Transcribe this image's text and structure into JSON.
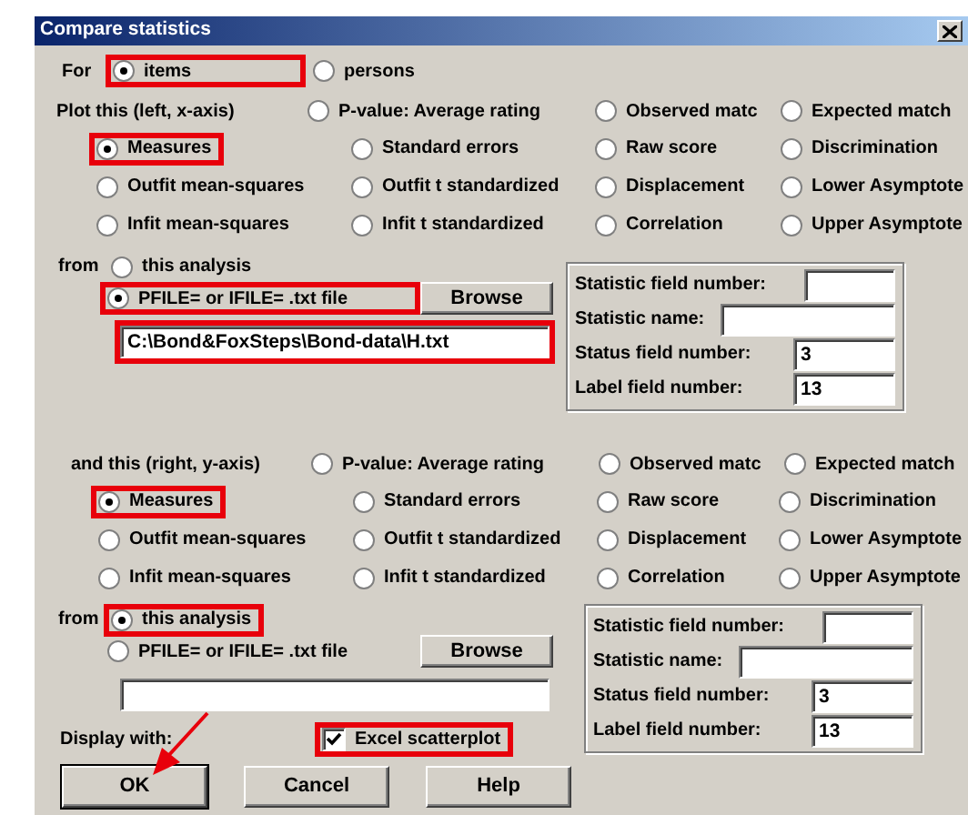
{
  "window": {
    "title": "Compare statistics"
  },
  "for": {
    "label": "For",
    "options": [
      {
        "label": "items",
        "selected": true,
        "highlighted": true
      },
      {
        "label": "persons",
        "selected": false,
        "highlighted": false
      }
    ]
  },
  "sections": [
    {
      "label": "Plot this (left, x-axis)",
      "statistics": [
        {
          "label": "P-value: Average rating",
          "selected": false,
          "highlighted": false
        },
        {
          "label": "Observed matc",
          "selected": false,
          "highlighted": false
        },
        {
          "label": "Expected match",
          "selected": false,
          "highlighted": false
        },
        {
          "label": "Measures",
          "selected": true,
          "highlighted": true
        },
        {
          "label": "Standard errors",
          "selected": false,
          "highlighted": false
        },
        {
          "label": "Raw score",
          "selected": false,
          "highlighted": false
        },
        {
          "label": "Discrimination",
          "selected": false,
          "highlighted": false
        },
        {
          "label": "Outfit mean-squares",
          "selected": false,
          "highlighted": false
        },
        {
          "label": "Outfit t standardized",
          "selected": false,
          "highlighted": false
        },
        {
          "label": "Displacement",
          "selected": false,
          "highlighted": false
        },
        {
          "label": "Lower Asymptote",
          "selected": false,
          "highlighted": false
        },
        {
          "label": "Infit mean-squares",
          "selected": false,
          "highlighted": false
        },
        {
          "label": "Infit t standardized",
          "selected": false,
          "highlighted": false
        },
        {
          "label": "Correlation",
          "selected": false,
          "highlighted": false
        },
        {
          "label": "Upper Asymptote",
          "selected": false,
          "highlighted": false
        }
      ],
      "from_label": "from",
      "sources": [
        {
          "label": "this analysis",
          "selected": false,
          "highlighted": false
        },
        {
          "label": "PFILE= or IFILE= .txt file",
          "selected": true,
          "highlighted": true
        }
      ],
      "browse": "Browse",
      "file_path": {
        "value": "C:\\Bond&FoxSteps\\Bond-data\\H.txt",
        "highlighted": true
      },
      "fields": [
        {
          "label": "Statistic field number:"
        },
        {
          "label": "Statistic name:"
        },
        {
          "label": "Status field number:",
          "value": "3"
        },
        {
          "label": "Label field number:",
          "value": "13"
        }
      ]
    },
    {
      "label": "and this (right, y-axis)",
      "statistics": [
        {
          "label": "P-value: Average rating",
          "selected": false,
          "highlighted": false
        },
        {
          "label": "Observed matc",
          "selected": false,
          "highlighted": false
        },
        {
          "label": "Expected match",
          "selected": false,
          "highlighted": false
        },
        {
          "label": "Measures",
          "selected": true,
          "highlighted": true
        },
        {
          "label": "Standard errors",
          "selected": false,
          "highlighted": false
        },
        {
          "label": "Raw score",
          "selected": false,
          "highlighted": false
        },
        {
          "label": "Discrimination",
          "selected": false,
          "highlighted": false
        },
        {
          "label": "Outfit mean-squares",
          "selected": false,
          "highlighted": false
        },
        {
          "label": "Outfit t standardized",
          "selected": false,
          "highlighted": false
        },
        {
          "label": "Displacement",
          "selected": false,
          "highlighted": false
        },
        {
          "label": "Lower Asymptote",
          "selected": false,
          "highlighted": false
        },
        {
          "label": "Infit mean-squares",
          "selected": false,
          "highlighted": false
        },
        {
          "label": "Infit t standardized",
          "selected": false,
          "highlighted": false
        },
        {
          "label": "Correlation",
          "selected": false,
          "highlighted": false
        },
        {
          "label": "Upper Asymptote",
          "selected": false,
          "highlighted": false
        }
      ],
      "from_label": "from",
      "sources": [
        {
          "label": "this analysis",
          "selected": true,
          "highlighted": true
        },
        {
          "label": "PFILE= or IFILE= .txt file",
          "selected": false,
          "highlighted": false
        }
      ],
      "browse": "Browse",
      "file_path": {
        "highlighted": false
      },
      "fields": [
        {
          "label": "Statistic field number:"
        },
        {
          "label": "Statistic name:"
        },
        {
          "label": "Status field number:",
          "value": "3"
        },
        {
          "label": "Label field number:",
          "value": "13"
        }
      ]
    }
  ],
  "display": {
    "label": "Display with:",
    "checkbox": {
      "label": "Excel scatterplot",
      "checked": true,
      "highlighted": true
    }
  },
  "buttons": [
    {
      "label": "OK",
      "default": true
    },
    {
      "label": "Cancel",
      "default": false
    },
    {
      "label": "Help",
      "default": false
    }
  ]
}
